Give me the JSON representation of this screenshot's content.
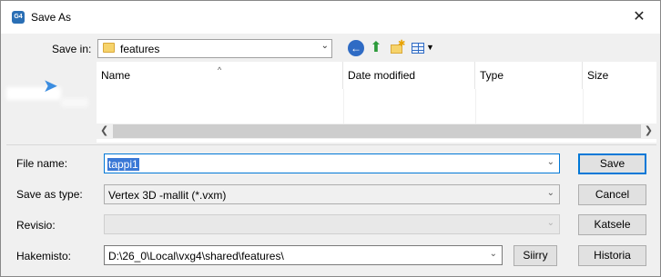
{
  "window": {
    "app_icon_text": "G4",
    "title": "Save As",
    "close_glyph": "✕"
  },
  "location": {
    "label": "Save in:",
    "value": "features"
  },
  "toolbar": {
    "icons": [
      "back-icon",
      "up-folder-icon",
      "new-folder-icon",
      "view-menu-icon"
    ]
  },
  "file_list": {
    "columns": [
      "Name",
      "Date modified",
      "Type",
      "Size"
    ],
    "sort_indicator": "^"
  },
  "form": {
    "file_name": {
      "label": "File name:",
      "value": "tappi1"
    },
    "save_as_type": {
      "label": "Save as type:",
      "value": "Vertex 3D -mallit (*.vxm)"
    },
    "revisio": {
      "label": "Revisio:",
      "value": ""
    },
    "hakemisto": {
      "label": "Hakemisto:",
      "value": "D:\\26_0\\Local\\vxg4\\shared\\features\\"
    }
  },
  "buttons": {
    "save": "Save",
    "cancel": "Cancel",
    "katsele": "Katsele",
    "siirry": "Siirry",
    "historia": "Historia"
  },
  "colors": {
    "accent": "#0078d7",
    "selection": "#3a78d6",
    "dialog_bg": "#f0f0f0"
  }
}
